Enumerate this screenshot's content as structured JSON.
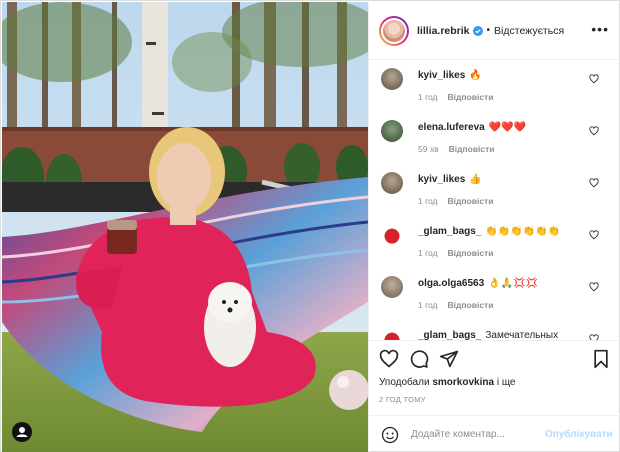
{
  "header": {
    "username": "lillia.rebrik",
    "separator": "•",
    "follow_label": "Відстежується",
    "more_label": "•••"
  },
  "comments": [
    {
      "username": "kyiv_likes",
      "text": "🔥",
      "time": "1 год",
      "reply": "Відповісти"
    },
    {
      "username": "elena.lufereva",
      "text": "❤️❤️❤️",
      "time": "59 хв",
      "reply": "Відповісти"
    },
    {
      "username": "kyiv_likes",
      "text": "👍",
      "time": "1 год",
      "reply": "Відповісти"
    },
    {
      "username": "_glam_bags_",
      "text": "👏👏👏👏👏👏",
      "time": "1 год",
      "reply": "Відповісти"
    },
    {
      "username": "olga.olga6563",
      "text": "👌🙏💢💢",
      "time": "1 год",
      "reply": "Відповісти"
    },
    {
      "username": "_glam_bags_",
      "text": "Замечательных",
      "time": "",
      "reply": ""
    }
  ],
  "actions": {
    "liked_by_prefix": "Уподобали",
    "liked_by_user": "smorkovkina",
    "liked_by_suffix": "і ще",
    "timestamp": "2 ГОД ТОМУ"
  },
  "add_comment": {
    "placeholder": "Додайте коментар...",
    "post_label": "Опублікувати"
  },
  "colors": {
    "accent_disabled": "#b3dbff",
    "text": "#262626",
    "secondary": "#8e8e8e",
    "border": "#efefef"
  },
  "icons": [
    "verified-badge-icon",
    "more-options-icon",
    "heart-icon",
    "comment-icon",
    "share-icon",
    "bookmark-icon",
    "emoji-icon",
    "user-tag-icon"
  ]
}
